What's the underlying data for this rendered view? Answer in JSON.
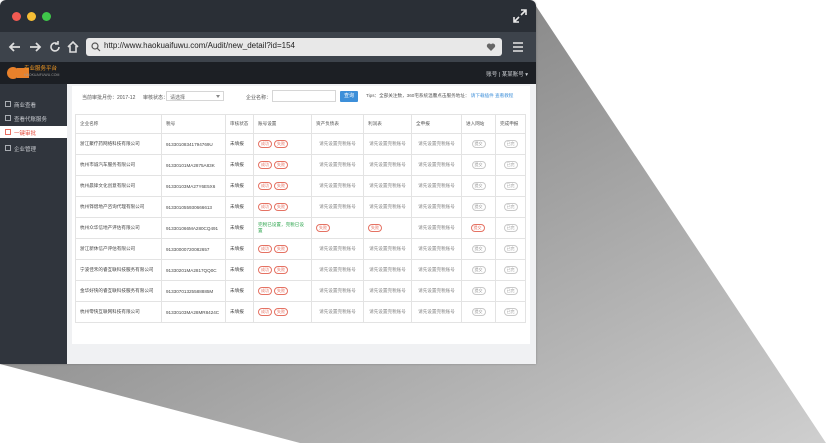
{
  "browser": {
    "url": "http://www.haokuaifuwu.com/Audit/new_detail?id=154"
  },
  "app": {
    "logo_text_cn": "好快",
    "logo_subtitle": "专业服务平台",
    "logo_domain": "HAOKUAIFUWU.COM",
    "user_label": "账号 | 某某账号 ▾"
  },
  "sidebar": {
    "items": [
      {
        "label": "商业查看"
      },
      {
        "label": "查看代账服务"
      },
      {
        "label": "一键审批"
      },
      {
        "label": "企业管理"
      }
    ]
  },
  "filters": {
    "period_label": "当前审批月份：2017-12",
    "status_label": "审核状态：",
    "status_value": "请选择",
    "company_label": "企业名称：",
    "company_placeholder": "",
    "search_button": "查询"
  },
  "tips": {
    "text": "Tips：全部关注数，360宅系统温馨点击服务地址：",
    "link1": "请下载插件",
    "link2": "查看教程"
  },
  "table": {
    "headers": [
      "企业名称",
      "税号",
      "审核状态",
      "账号设置",
      "资产负债表",
      "利润表",
      "全申报",
      "进入网站",
      "完成申报"
    ],
    "default_cell": "请先设置完税账号",
    "tag_labels": {
      "pass": "成功",
      "fail": "失败",
      "submit": "提交",
      "done": "已完"
    },
    "rows": [
      {
        "company": "浙江聚疗药网络科技有限公司",
        "tax_id": "91330108341794769U",
        "status": "未填报"
      },
      {
        "company": "杭州市诚汽车服务有限公司",
        "tax_id": "91330101MA2875A83K",
        "status": "未填报"
      },
      {
        "company": "杭州晨锋文化创意有限公司",
        "tax_id": "91330103MA27Y6E5X6",
        "status": "未填报"
      },
      {
        "company": "杭州铧熠地产咨询代理有限公司",
        "tax_id": "913301055930666613",
        "status": "未填报"
      },
      {
        "company": "杭州众华信地产评估有限公司",
        "tax_id": "913301066MA280CQ491",
        "status": "未填报",
        "note": "完税已设置，完税已设置"
      },
      {
        "company": "浙江新休信产评估有限公司",
        "tax_id": "91330000720082657",
        "status": "未填报"
      },
      {
        "company": "宁波佳禾的睿互联科技服务有限公司",
        "tax_id": "91330201MA2817QQ0C",
        "status": "未填报"
      },
      {
        "company": "金华好快的睿互联科技服务有限公司",
        "tax_id": "91330701325588885M",
        "status": "未填报"
      },
      {
        "company": "杭州零快互联网科技有限公司",
        "tax_id": "91330103MA28MR8424C",
        "status": "未填报"
      }
    ]
  }
}
